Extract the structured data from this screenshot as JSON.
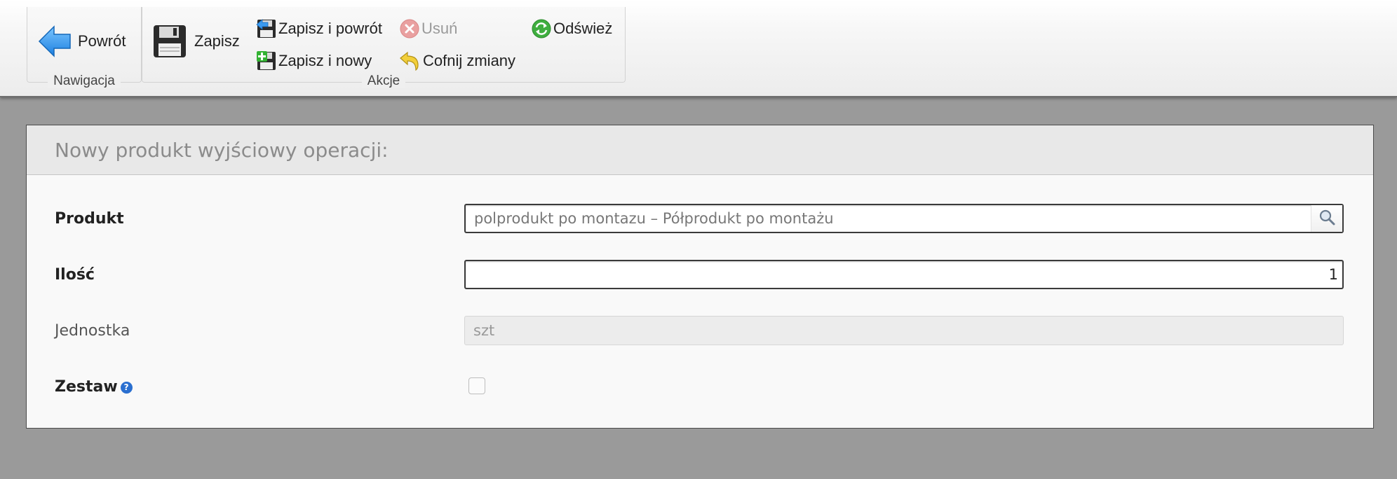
{
  "ribbon": {
    "navigation": {
      "label": "Nawigacja",
      "back": "Powrót"
    },
    "actions": {
      "label": "Akcje",
      "save": "Zapisz",
      "save_back": "Zapisz i powrót",
      "save_new": "Zapisz i nowy",
      "delete": "Usuń",
      "undo": "Cofnij zmiany",
      "refresh": "Odśwież"
    }
  },
  "form": {
    "title": "Nowy produkt wyjściowy operacji:",
    "product": {
      "label": "Produkt",
      "value": "polprodukt po montazu – Półprodukt po montażu"
    },
    "quantity": {
      "label": "Ilość",
      "value": "1"
    },
    "unit": {
      "label": "Jednostka",
      "value": "szt"
    },
    "set": {
      "label": "Zestaw",
      "help": "?",
      "checked": false
    }
  }
}
